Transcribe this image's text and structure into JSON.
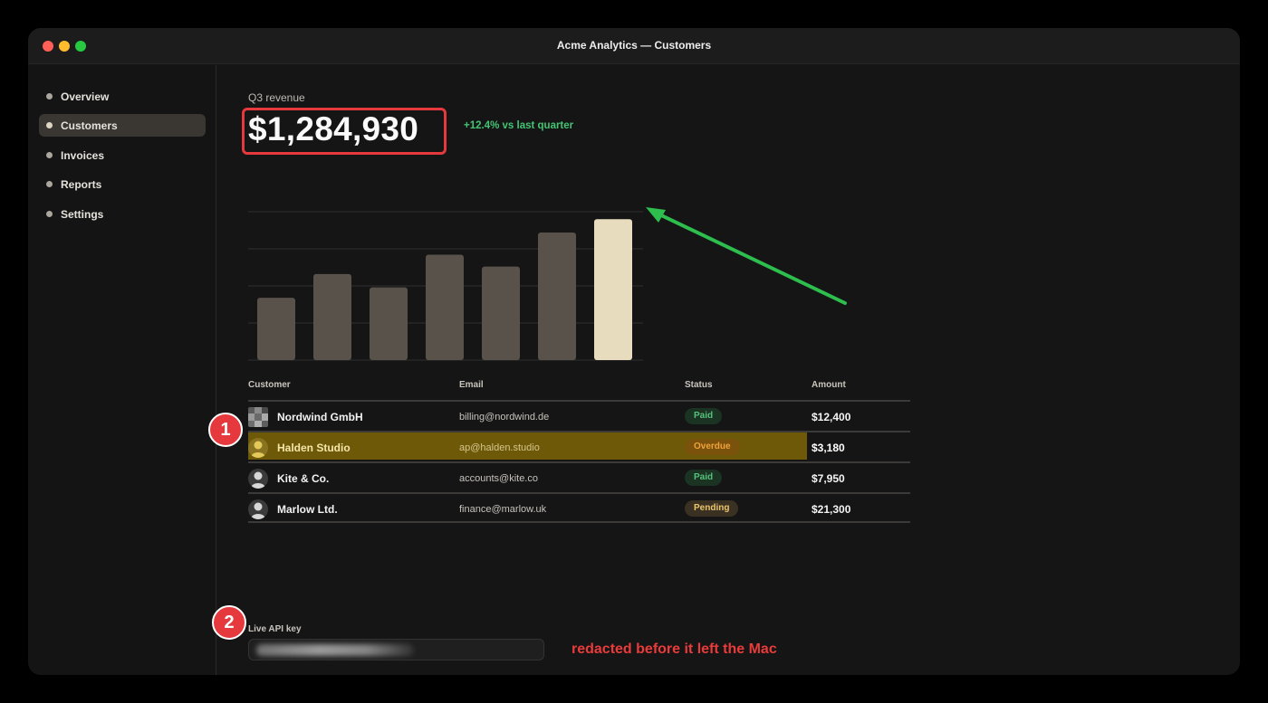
{
  "window": {
    "title": "Acme Analytics — Customers"
  },
  "sidebar": {
    "items": [
      {
        "label": "Overview",
        "active": false
      },
      {
        "label": "Customers",
        "active": true
      },
      {
        "label": "Invoices",
        "active": false
      },
      {
        "label": "Reports",
        "active": false
      },
      {
        "label": "Settings",
        "active": false
      }
    ]
  },
  "kpi": {
    "label": "Q3 revenue",
    "value": "$1,284,930",
    "delta": "+12.4% vs last quarter"
  },
  "chart_data": {
    "type": "bar",
    "title": "",
    "xlabel": "",
    "ylabel": "",
    "values": [
      42,
      58,
      49,
      71,
      63,
      86,
      95
    ],
    "ylim": [
      0,
      100
    ],
    "grid": true,
    "highlight_index": 6,
    "colors": {
      "bar": "#58524a",
      "highlight": "#e8dcbf",
      "grid": "#2f2f2f"
    }
  },
  "table": {
    "headers": {
      "customer": "Customer",
      "email": "Email",
      "status": "Status",
      "amount": "Amount"
    },
    "rows": [
      {
        "customer": "Nordwind GmbH",
        "email": "billing@nordwind.de",
        "status": "Paid",
        "status_kind": "paid",
        "amount": "$12,400",
        "avatar": "pixelated"
      },
      {
        "customer": "Halden Studio",
        "email": "ap@halden.studio",
        "status": "Overdue",
        "status_kind": "overdue",
        "amount": "$3,180",
        "avatar": "person",
        "highlighted": true
      },
      {
        "customer": "Kite & Co.",
        "email": "accounts@kite.co",
        "status": "Paid",
        "status_kind": "paid",
        "amount": "$7,950",
        "avatar": "person"
      },
      {
        "customer": "Marlow Ltd.",
        "email": "finance@marlow.uk",
        "status": "Pending",
        "status_kind": "pending",
        "amount": "$21,300",
        "avatar": "person"
      }
    ]
  },
  "api_key": {
    "label": "Live API key",
    "value_state": "redacted"
  },
  "annotations": {
    "callout_1": "1",
    "callout_2": "2",
    "redaction_note": "redacted before it left the Mac",
    "colors": {
      "callout": "#e5393d",
      "arrow": "#2dbe4e",
      "highlight": "#6e5908",
      "box": "#e5393d"
    }
  }
}
